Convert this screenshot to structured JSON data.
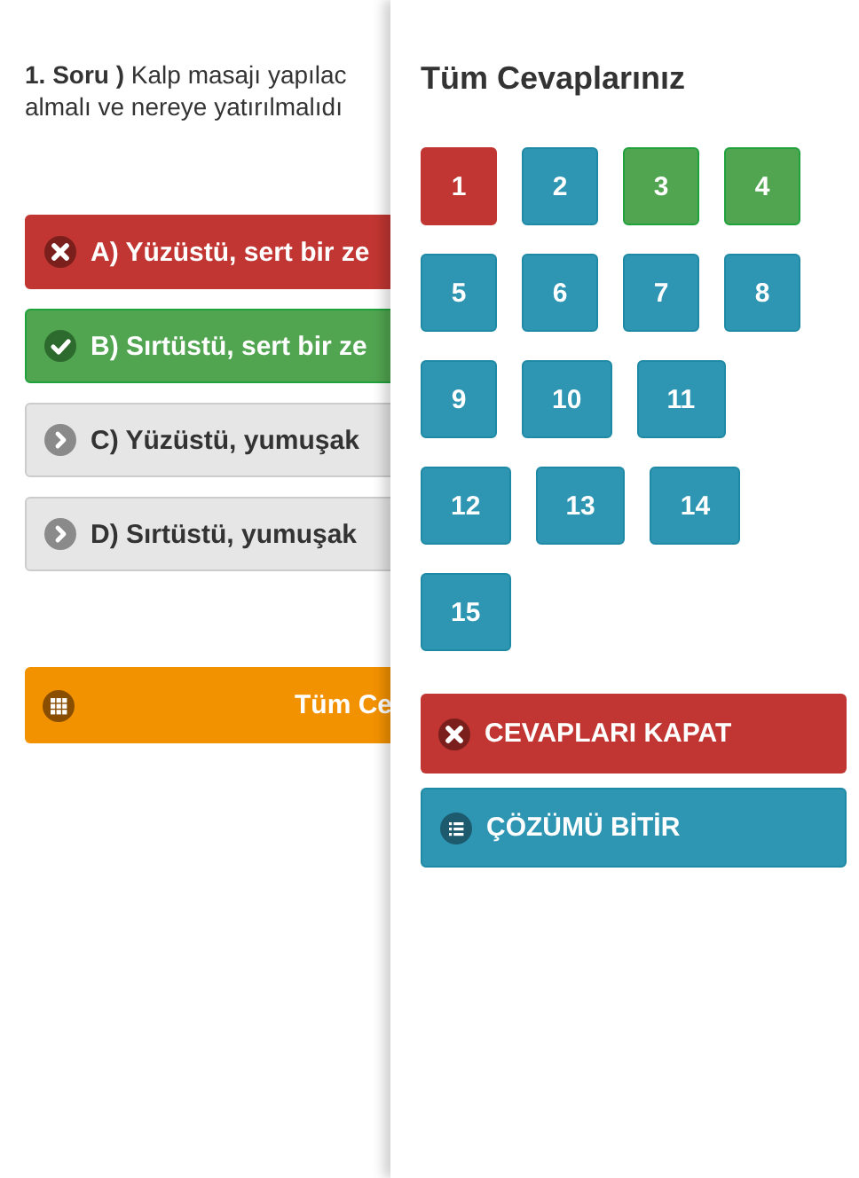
{
  "question": {
    "lines": [
      "**1. Soru )** Kalp masajı yapılac",
      "almalı ve nereye yatırılmalıdı"
    ]
  },
  "options": [
    {
      "text": "A) Yüzüstü, sert bir ze",
      "wrong": true,
      "correct": false
    },
    {
      "text": "B) Sırtüstü, sert bir ze",
      "wrong": false,
      "correct": true
    },
    {
      "text": "C) Yüzüstü, yumuşak",
      "wrong": false,
      "correct": false
    },
    {
      "text": "D) Sırtüstü, yumuşak",
      "wrong": false,
      "correct": false
    }
  ],
  "all_answers_button": {
    "label": "Tüm Ce"
  },
  "panel": {
    "title": "Tüm Cevaplarınız",
    "rows": [
      [
        {
          "number": "1",
          "wrong": true,
          "correct": false
        },
        {
          "number": "2",
          "wrong": false,
          "correct": false
        },
        {
          "number": "3",
          "wrong": false,
          "correct": true
        },
        {
          "number": "4",
          "wrong": false,
          "correct": true
        }
      ],
      [
        {
          "number": "5",
          "wrong": false,
          "correct": false
        },
        {
          "number": "6",
          "wrong": false,
          "correct": false
        },
        {
          "number": "7",
          "wrong": false,
          "correct": false
        },
        {
          "number": "8",
          "wrong": false,
          "correct": false
        }
      ],
      [
        {
          "number": "9",
          "wrong": false,
          "correct": false
        },
        {
          "number": "10",
          "wrong": false,
          "correct": false
        },
        {
          "number": "11",
          "wrong": false,
          "correct": false
        }
      ],
      [
        {
          "number": "12",
          "wrong": false,
          "correct": false
        },
        {
          "number": "13",
          "wrong": false,
          "correct": false
        },
        {
          "number": "14",
          "wrong": false,
          "correct": false
        }
      ],
      [
        {
          "number": "15",
          "wrong": false,
          "correct": false
        }
      ]
    ],
    "buttons": [
      {
        "label": "CEVAPLARI KAPAT",
        "kind": "close"
      },
      {
        "label": "ÇÖZÜMÜ BİTİR",
        "kind": "finish"
      }
    ]
  }
}
